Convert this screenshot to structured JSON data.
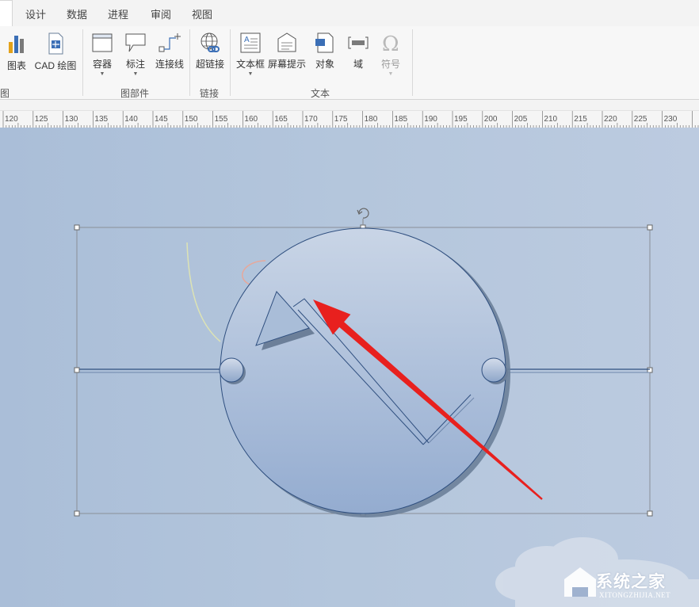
{
  "tabs": [
    {
      "label": "设计"
    },
    {
      "label": "数据"
    },
    {
      "label": "进程"
    },
    {
      "label": "审阅"
    },
    {
      "label": "视图"
    }
  ],
  "ribbon": {
    "buttons": {
      "chart": "图表",
      "cad": "CAD 绘图",
      "container": "容器",
      "callout": "标注",
      "connector": "连接线",
      "hyperlink": "超链接",
      "textbox": "文本框",
      "screentip": "屏幕提示",
      "object": "对象",
      "field": "域",
      "symbol": "符号"
    },
    "groups": {
      "illustrations": "图",
      "diagram_parts": "图部件",
      "links": "链接",
      "text": "文本"
    }
  },
  "ruler": {
    "ticks": [
      "120",
      "125",
      "130",
      "135",
      "140",
      "145",
      "150",
      "155",
      "160",
      "165",
      "170",
      "175",
      "180",
      "185",
      "190",
      "195",
      "200",
      "205",
      "210",
      "215",
      "220",
      "225",
      "230"
    ]
  },
  "colors": {
    "accent_arrow": "#e8201e",
    "shape_stroke": "#2f4f7f",
    "canvas": "#b4c6dc"
  },
  "watermark": {
    "text": "系统之家",
    "url": "XITONGZHIJIA.NET"
  }
}
